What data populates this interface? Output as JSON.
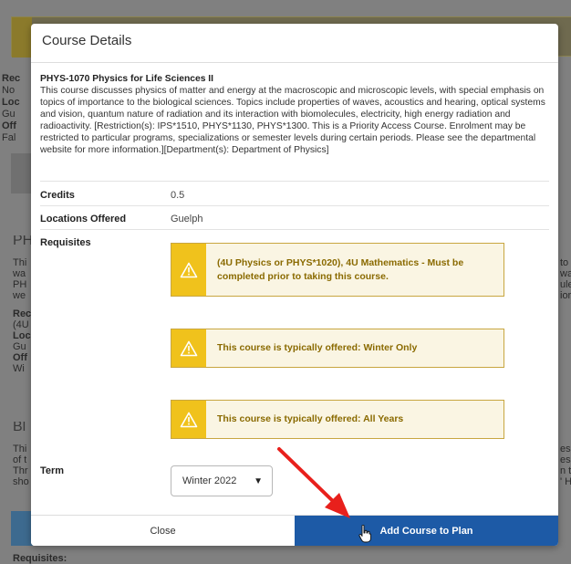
{
  "background": {
    "left_fragments": [
      {
        "text": "Rec",
        "bold": true
      },
      {
        "text": "No",
        "bold": false
      },
      {
        "text": "Loc",
        "bold": true
      },
      {
        "text": "Gu",
        "bold": false
      },
      {
        "text": "Off",
        "bold": true
      },
      {
        "text": "Fal",
        "bold": false
      }
    ],
    "section2_heading": "PH",
    "section2_lines": [
      "Thi",
      "wa",
      "PH",
      "we"
    ],
    "section2_details": [
      {
        "text": "Rec",
        "bold": true
      },
      {
        "text": "(4U",
        "bold": false
      },
      {
        "text": "Loc",
        "bold": true
      },
      {
        "text": "Gu",
        "bold": false
      },
      {
        "text": "Off",
        "bold": true
      },
      {
        "text": "Wi",
        "bold": false
      }
    ],
    "section3_heading": "Bl",
    "section3_lines": [
      "Thi",
      "of t",
      "Thr",
      "sho"
    ],
    "right_fragments_1": [
      "to",
      "wa",
      "ule",
      "ior"
    ],
    "right_fragments_2": [
      "es c",
      "es d",
      "n to",
      "' H"
    ],
    "bottom_label": "Requisites:"
  },
  "modal": {
    "title": "Course Details",
    "course_title": "PHYS-1070 Physics for Life Sciences II",
    "course_description": "This course discusses physics of matter and energy at the macroscopic and microscopic levels, with special emphasis on topics of importance to the biological sciences. Topics include properties of waves, acoustics and hearing, optical systems and vision, quantum nature of radiation and its interaction with biomolecules, electricity, high energy radiation and radioactivity. [Restriction(s): IPS*1510, PHYS*1130, PHYS*1300. This is a Priority Access Course. Enrolment may be restricted to particular programs, specializations or semester levels during certain periods. Please see the departmental website for more information.][Department(s): Department of Physics]",
    "credits_label": "Credits",
    "credits_value": "0.5",
    "locations_label": "Locations Offered",
    "locations_value": "Guelph",
    "requisites_label": "Requisites",
    "alerts": [
      "(4U Physics or PHYS*1020), 4U Mathematics - Must be completed prior to taking this course.",
      "This course is typically offered: Winter Only",
      "This course is typically offered: All Years"
    ],
    "term_label": "Term",
    "term_value": "Winter 2022",
    "close_label": "Close",
    "add_label": "Add Course to Plan"
  },
  "colors": {
    "primary_button": "#1d5aa6",
    "alert_icon_bg": "#f0c21c",
    "alert_bg": "#faf5e3",
    "alert_text": "#8a6a00",
    "annotation_arrow": "#e8201c"
  },
  "icons": {
    "alert": "warning-triangle-icon",
    "select": "chevron-down-icon",
    "pointer": "hand-cursor-icon"
  }
}
